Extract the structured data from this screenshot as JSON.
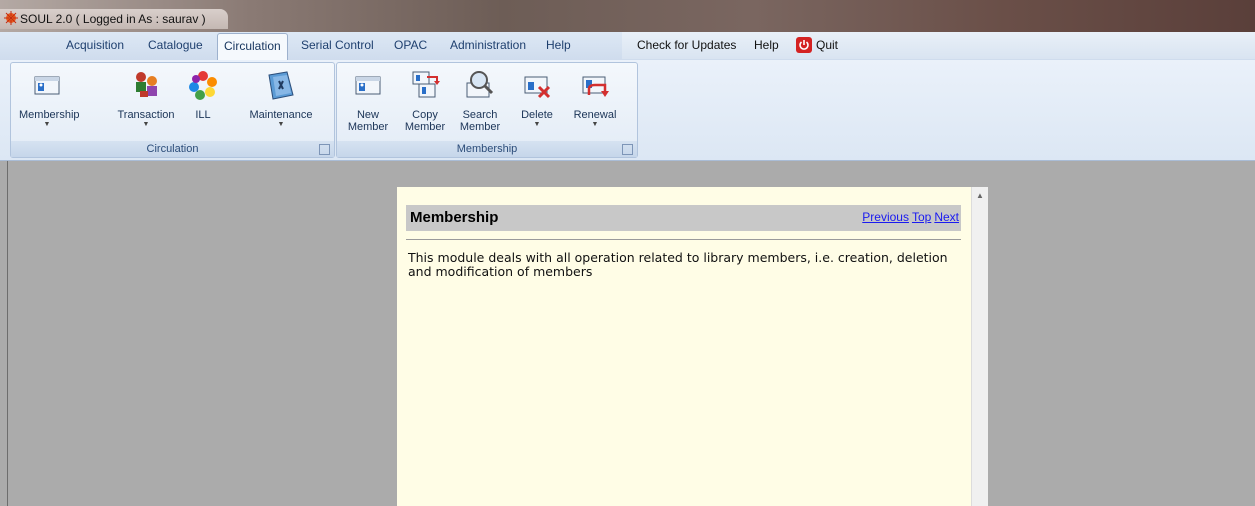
{
  "window": {
    "title": "SOUL 2.0  ( Logged in As : saurav )"
  },
  "tabs": [
    "Acquisition",
    "Catalogue",
    "Circulation",
    "Serial Control",
    "OPAC",
    "Administration",
    "Help"
  ],
  "active_tab": "Circulation",
  "right_menu": {
    "updates": "Check for Updates",
    "help": "Help",
    "quit": "Quit"
  },
  "ribbon": {
    "circulation_group": {
      "label": "Circulation",
      "buttons": [
        "Membership",
        "Transaction",
        "ILL",
        "Maintenance"
      ]
    },
    "membership_group": {
      "label": "Membership",
      "new_member": [
        "New",
        "Member"
      ],
      "copy_member": [
        "Copy",
        "Member"
      ],
      "search_member": [
        "Search",
        "Member"
      ],
      "delete": "Delete",
      "renewal": "Renewal"
    }
  },
  "help": {
    "title": "Membership",
    "links": [
      "Previous",
      "Top",
      "Next"
    ],
    "body": "This module deals with all operation related to library members, i.e. creation, deletion and modification of members"
  },
  "icons": [
    "app-icon",
    "quit-icon",
    "membership-icon",
    "transaction-icon",
    "ill-icon",
    "maintenance-icon",
    "new-member-icon",
    "copy-member-icon",
    "search-member-icon",
    "delete-icon",
    "renewal-icon"
  ]
}
